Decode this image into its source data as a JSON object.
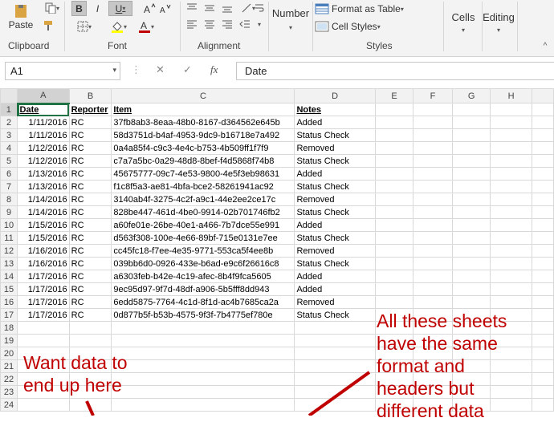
{
  "ribbon": {
    "clipboard": {
      "paste_label": "Paste",
      "group_label": "Clipboard"
    },
    "font": {
      "bold": "B",
      "italic": "I",
      "underline": "U",
      "group_label": "Font"
    },
    "alignment": {
      "group_label": "Alignment"
    },
    "number": {
      "label": "Number"
    },
    "styles": {
      "format_as_table": "Format as Table",
      "cell_styles": "Cell Styles",
      "group_label": "Styles"
    },
    "cells": {
      "label": "Cells"
    },
    "editing": {
      "label": "Editing"
    }
  },
  "formula_bar": {
    "name_box": "A1",
    "cancel_icon": "✕",
    "enter_icon": "✓",
    "fx": "fx",
    "content": "Date"
  },
  "columns": [
    "A",
    "B",
    "C",
    "D",
    "E",
    "F",
    "G",
    "H"
  ],
  "headers": [
    "Date",
    "Reporter",
    "Item",
    "Notes"
  ],
  "rows": [
    [
      "1/11/2016",
      "RC",
      "37fb8ab3-8eaa-48b0-8167-d364562e645b",
      "Added"
    ],
    [
      "1/11/2016",
      "RC",
      "58d3751d-b4af-4953-9dc9-b16718e7a492",
      "Status Check"
    ],
    [
      "1/12/2016",
      "RC",
      "0a4a85f4-c9c3-4e4c-b753-4b509ff1f7f9",
      "Removed"
    ],
    [
      "1/12/2016",
      "RC",
      "c7a7a5bc-0a29-48d8-8bef-f4d5868f74b8",
      "Status Check"
    ],
    [
      "1/13/2016",
      "RC",
      "45675777-09c7-4e53-9800-4e5f3eb98631",
      "Added"
    ],
    [
      "1/13/2016",
      "RC",
      "f1c8f5a3-ae81-4bfa-bce2-58261941ac92",
      "Status Check"
    ],
    [
      "1/14/2016",
      "RC",
      "3140ab4f-3275-4c2f-a9c1-44e2ee2ce17c",
      "Removed"
    ],
    [
      "1/14/2016",
      "RC",
      "828be447-461d-4be0-9914-02b701746fb2",
      "Status Check"
    ],
    [
      "1/15/2016",
      "RC",
      "a60fe01e-26be-40e1-a466-7b7dce55e991",
      "Added"
    ],
    [
      "1/15/2016",
      "RC",
      "d563f308-100e-4e66-89bf-715e0131e7ee",
      "Status Check"
    ],
    [
      "1/16/2016",
      "RC",
      "cc45fc18-f7ee-4e35-9771-553ca5f4ee8b",
      "Removed"
    ],
    [
      "1/16/2016",
      "RC",
      "039bb6d0-0926-433e-b6ad-e9c6f26616c8",
      "Status Check"
    ],
    [
      "1/17/2016",
      "RC",
      "a6303feb-b42e-4c19-afec-8b4f9fca5605",
      "Added"
    ],
    [
      "1/17/2016",
      "RC",
      "9ec95d97-9f7d-48df-a906-5b5fff8dd943",
      "Added"
    ],
    [
      "1/17/2016",
      "RC",
      "6edd5875-7764-4c1d-8f1d-ac4b7685ca2a",
      "Removed"
    ],
    [
      "1/17/2016",
      "RC",
      "0d877b5f-b53b-4575-9f3f-7b4775ef780e",
      "Status Check"
    ]
  ],
  "row_numbers": [
    "1",
    "2",
    "3",
    "4",
    "5",
    "6",
    "7",
    "8",
    "9",
    "10",
    "11",
    "12",
    "13",
    "14",
    "15",
    "16",
    "17",
    "18",
    "19",
    "20",
    "21",
    "22",
    "23",
    "24"
  ],
  "annotations": {
    "left": "Want data to\nend up here",
    "right": "All these sheets\nhave the same\nformat and\nheaders but\ndifferent data"
  },
  "colors": {
    "accent": "#217346",
    "annotation": "#c00000"
  }
}
